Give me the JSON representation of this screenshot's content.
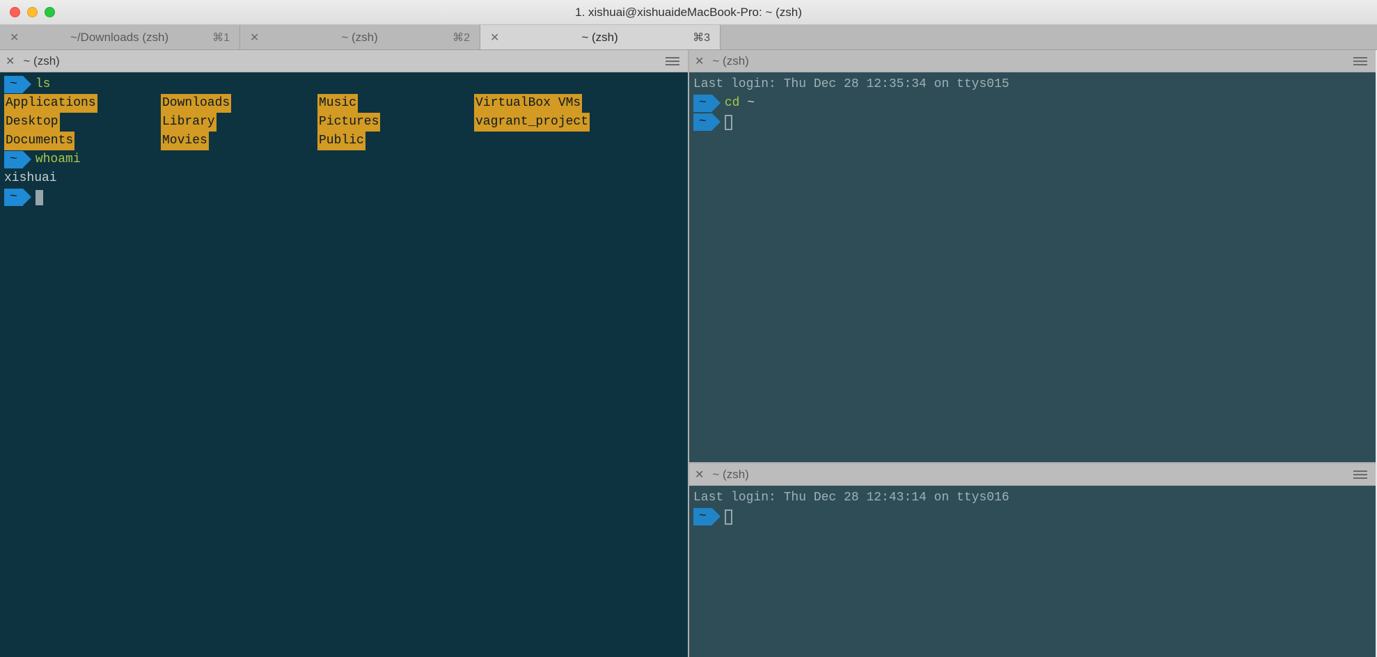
{
  "titlebar": {
    "title": "1. xishuai@xishuaideMacBook-Pro: ~ (zsh)"
  },
  "window_tabs": [
    {
      "label": "~/Downloads (zsh)",
      "shortcut": "⌘1",
      "active": false
    },
    {
      "label": "~ (zsh)",
      "shortcut": "⌘2",
      "active": false
    },
    {
      "label": "~ (zsh)",
      "shortcut": "⌘3",
      "active": true
    }
  ],
  "panes": {
    "left": {
      "title": "~ (zsh)",
      "prompt_symbol": "~",
      "lines": {
        "cmd1": "ls",
        "ls_columns": [
          [
            "Applications",
            "Desktop",
            "Documents"
          ],
          [
            "Downloads",
            "Library",
            "Movies"
          ],
          [
            "Music",
            "Pictures",
            "Public"
          ],
          [
            "VirtualBox VMs",
            "vagrant_project"
          ]
        ],
        "cmd2": "whoami",
        "out2": "xishuai"
      }
    },
    "right_top": {
      "title": "~ (zsh)",
      "login": "Last login: Thu Dec 28 12:35:34 on ttys015",
      "prompt_symbol": "~",
      "cmd1": "cd",
      "cmd1_arg": "~"
    },
    "right_bottom": {
      "title": "~ (zsh)",
      "login": "Last login: Thu Dec 28 12:43:14 on ttys016",
      "prompt_symbol": "~"
    }
  }
}
